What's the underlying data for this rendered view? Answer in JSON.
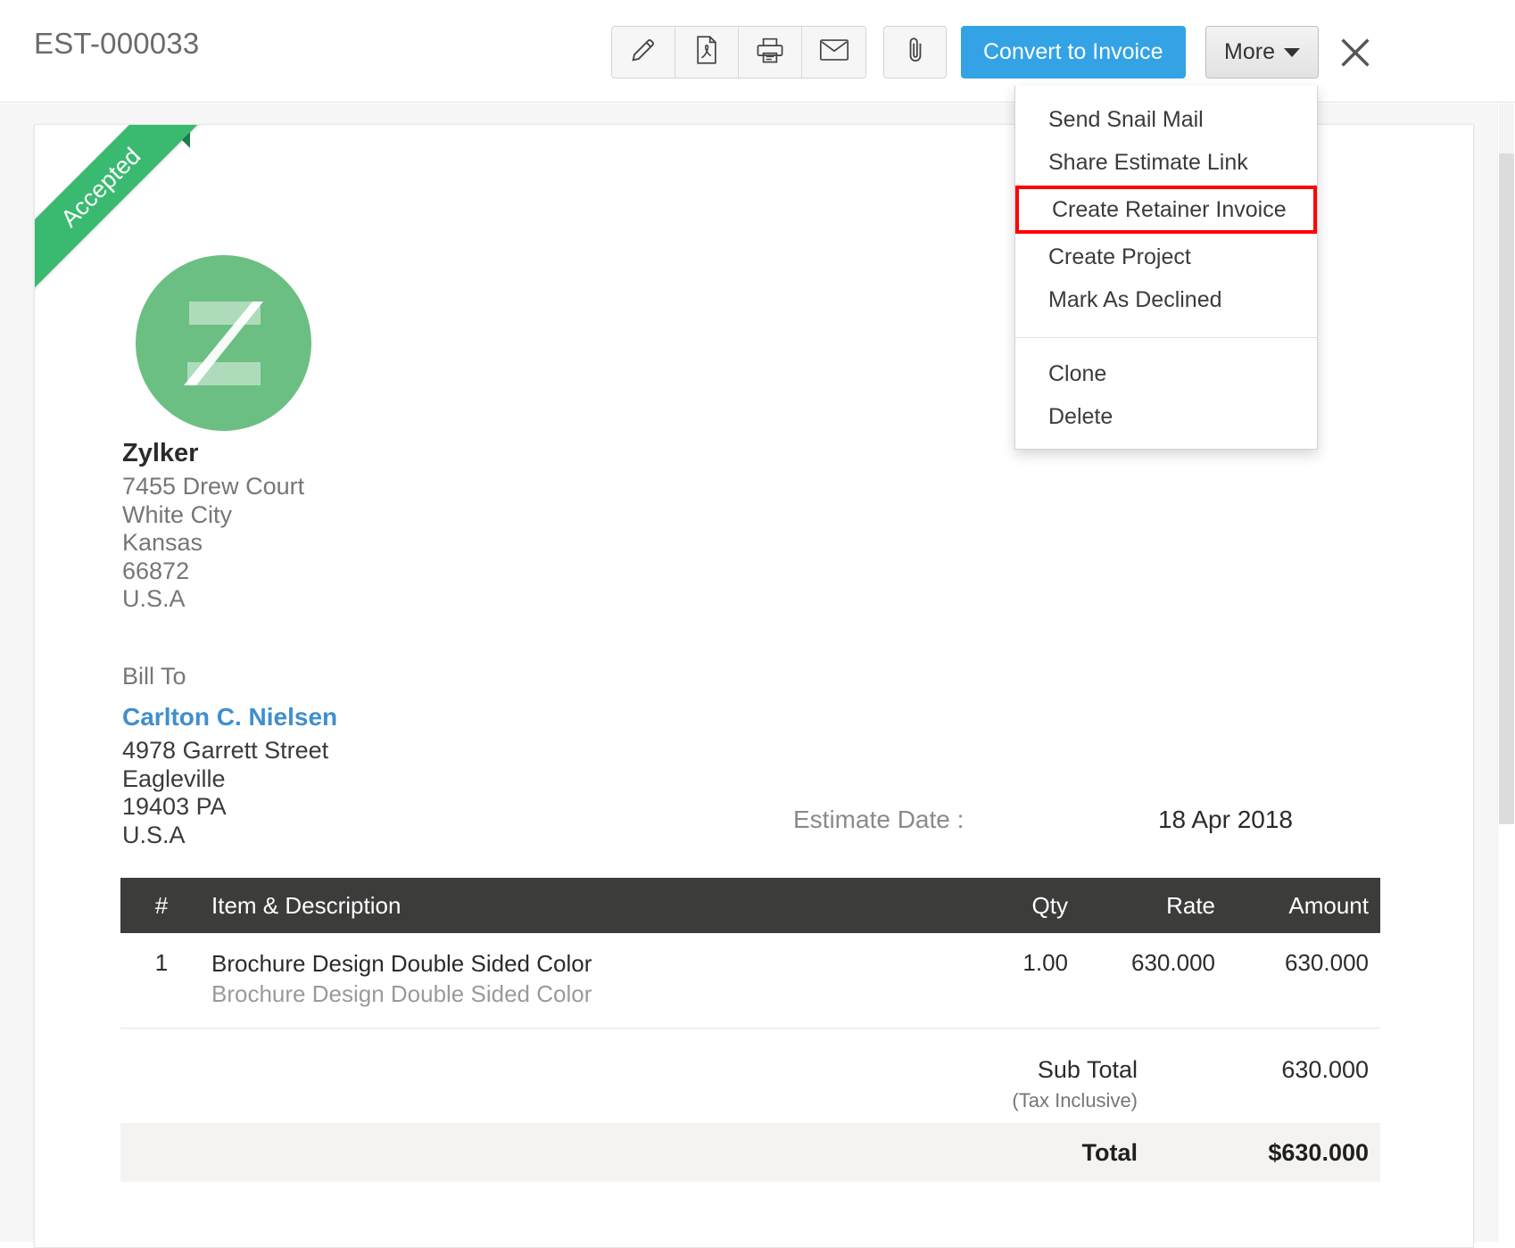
{
  "header": {
    "doc_number": "EST-000033",
    "icon_buttons": [
      {
        "name": "edit-icon",
        "label": "Edit"
      },
      {
        "name": "pdf-icon",
        "label": "PDF"
      },
      {
        "name": "print-icon",
        "label": "Print"
      },
      {
        "name": "email-icon",
        "label": "Email"
      }
    ],
    "attach_icon_label": "Attach",
    "convert_label": "Convert to Invoice",
    "more_label": "More",
    "close_label": "Close"
  },
  "dropdown": {
    "groups": [
      {
        "items": [
          {
            "label": "Send Snail Mail",
            "highlighted": false
          },
          {
            "label": "Share Estimate Link",
            "highlighted": false
          },
          {
            "label": "Create Retainer Invoice",
            "highlighted": true
          },
          {
            "label": "Create Project",
            "highlighted": false
          },
          {
            "label": "Mark As Declined",
            "highlighted": false
          }
        ]
      },
      {
        "items": [
          {
            "label": "Clone",
            "highlighted": false
          },
          {
            "label": "Delete",
            "highlighted": false
          }
        ]
      }
    ],
    "highlight_color": "#ff0000"
  },
  "document": {
    "status_ribbon": "Accepted",
    "ribbon_color": "#3aba70",
    "logo_letter": "Z",
    "organization": {
      "name": "Zylker",
      "address_lines": [
        "7455 Drew Court",
        "White City",
        "Kansas",
        "66872",
        "U.S.A"
      ]
    },
    "bill_to": {
      "label": "Bill To",
      "name": "Carlton C. Nielsen",
      "address_lines": [
        "4978 Garrett Street",
        "Eagleville",
        "19403 PA",
        "U.S.A"
      ],
      "link_color": "#3f8fce"
    },
    "estimate_date": {
      "label": "Estimate Date :",
      "value": "18 Apr 2018"
    },
    "table": {
      "columns": [
        "#",
        "Item & Description",
        "Qty",
        "Rate",
        "Amount"
      ],
      "rows": [
        {
          "index": "1",
          "item": "Brochure Design Double Sided Color",
          "description": "Brochure Design Double Sided Color",
          "qty": "1.00",
          "rate": "630.000",
          "amount": "630.000"
        }
      ]
    },
    "totals": {
      "sub_total_label": "Sub Total",
      "sub_total_note": "(Tax Inclusive)",
      "sub_total_value": "630.000",
      "total_label": "Total",
      "total_value": "$630.000"
    }
  }
}
